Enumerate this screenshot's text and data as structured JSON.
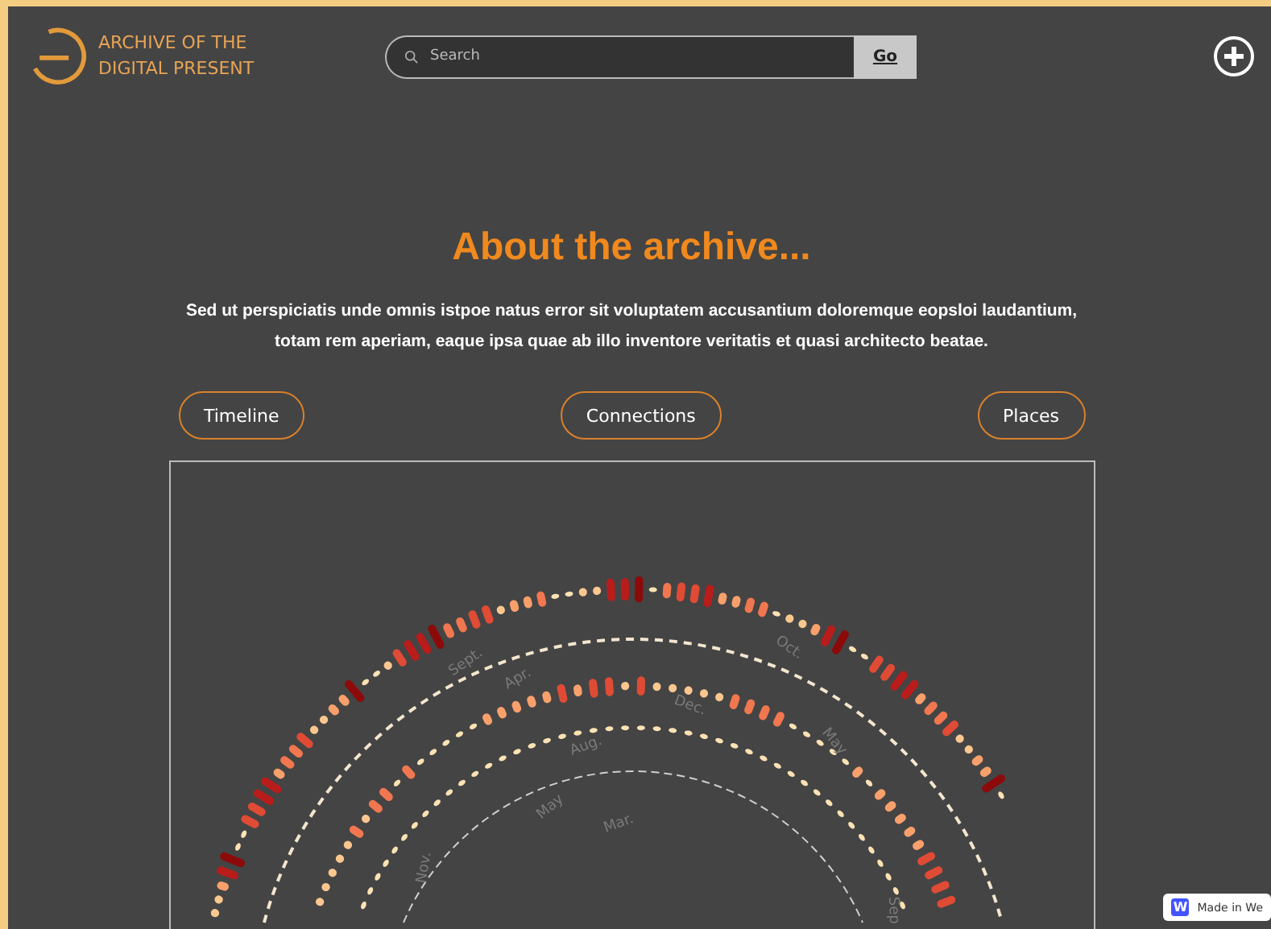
{
  "header": {
    "site_name_lines": [
      "ARCHIVE OF THE",
      "DIGITAL PRESENT"
    ],
    "search": {
      "placeholder": "Search",
      "button": "Go"
    }
  },
  "intro": {
    "title": "About the archive...",
    "text": "Sed ut perspiciatis unde omnis istpoe natus error sit voluptatem accusantium doloremque eopsloi laudantium, totam rem aperiam, eaque ipsa quae ab illo inventore veritatis et quasi architecto beatae."
  },
  "views": [
    {
      "label": "Timeline"
    },
    {
      "label": "Connections"
    },
    {
      "label": "Places"
    }
  ],
  "spiral": {
    "month_labels": [
      "Oct.",
      "Dec.",
      "May",
      "Sept.",
      "Apr.",
      "Aug.",
      "May",
      "Mar.",
      "Nov.",
      "Sep"
    ]
  },
  "badge": {
    "logo_letter": "W",
    "text": "Made in We"
  }
}
